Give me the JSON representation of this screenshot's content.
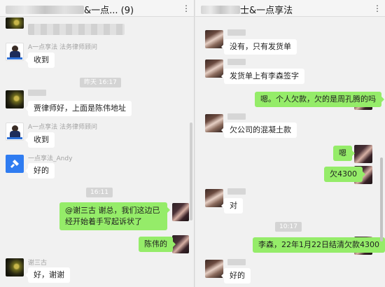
{
  "left": {
    "title": "&一点... (9)",
    "menu": "⋮",
    "messages": {
      "m1_sender": "A一点享法 法务律师顾问",
      "m1_text": "收到",
      "time1": "昨天 16:17",
      "m2_text": "贾律师好，上面是陈伟地址",
      "m3_sender": "A一点享法 法务律师顾问",
      "m3_text": "收到",
      "m4_sender": "一点享法_Andy",
      "m4_text": "好的",
      "time2": "16:11",
      "m5_text": "@谢三古 谢总，我们这边已经开始着手写起诉状了",
      "m6_text": "陈伟的",
      "m7_sender": "谢三古",
      "m7_text": "好，谢谢"
    }
  },
  "right": {
    "title": "士&一点享法",
    "menu": "⋮",
    "messages": {
      "r1": "没有，只有发货单",
      "r2": "发货单上有李森签字",
      "r3": "嗯。个人欠款，欠的是周孔腾的吗",
      "r4": "欠公司的混凝土款",
      "r5": "嗯",
      "r6": "欠4300",
      "r7": "对",
      "time": "10:17",
      "r8": "李森，22年1月22日结清欠款4300",
      "r9": "好的"
    }
  },
  "colors": {
    "outgoing": "#95ec69",
    "incoming": "#ffffff",
    "background": "#f1f1f1"
  }
}
